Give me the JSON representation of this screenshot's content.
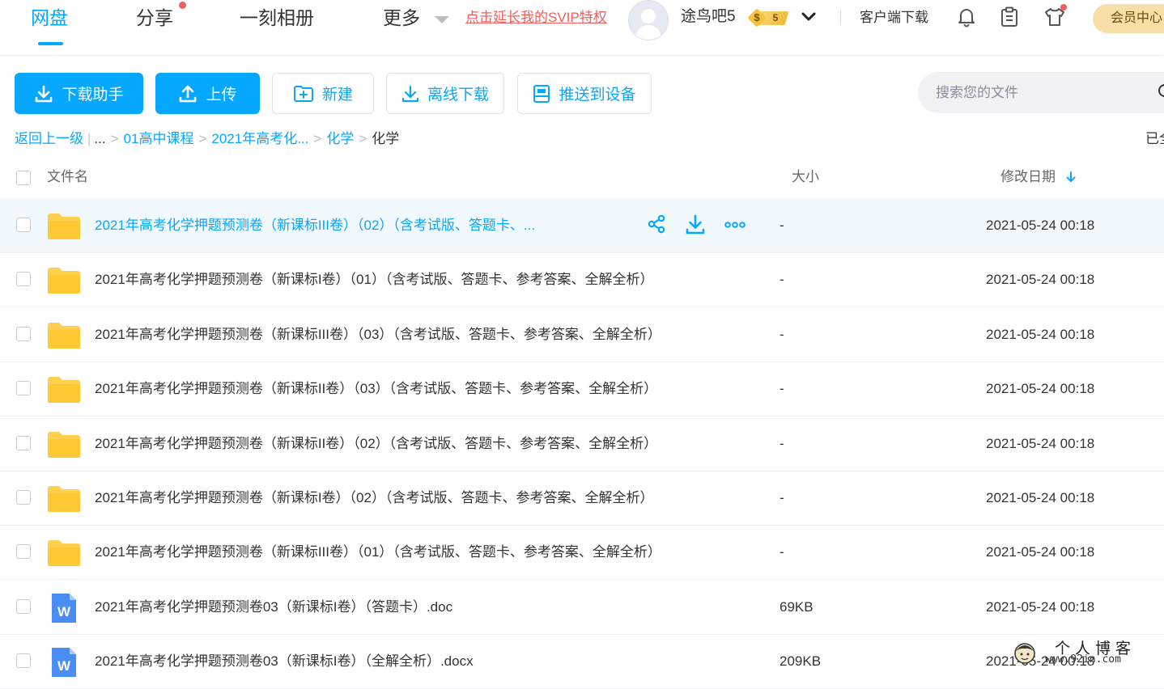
{
  "nav": {
    "tabs": [
      "网盘",
      "分享",
      "一刻相册",
      "更多"
    ],
    "svip_link": "点击延长我的SVIP特权",
    "username": "途鸟吧5",
    "coin_level": "5",
    "coin_symbol": "$",
    "client_download": "客户端下载",
    "vip_center": "会员中心"
  },
  "toolbar": {
    "download_helper": "下载助手",
    "upload": "上传",
    "new": "新建",
    "offline_download": "离线下载",
    "push_to_device": "推送到设备",
    "search_placeholder": "搜索您的文件"
  },
  "breadcrumb": {
    "back": "返回上一级",
    "ellipsis": "...",
    "items": [
      "01高中课程",
      "2021年高考化...",
      "化学",
      "化学"
    ],
    "loaded_status": "已全"
  },
  "table": {
    "headers": {
      "name": "文件名",
      "size": "大小",
      "date": "修改日期"
    },
    "rows": [
      {
        "name": "2021年高考化学押题预测卷（新课标III卷）（02）（含考试版、答题卡、...",
        "size": "-",
        "date": "2021-05-24 00:18",
        "type": "folder"
      },
      {
        "name": "2021年高考化学押题预测卷（新课标I卷）（01）（含考试版、答题卡、参考答案、全解全析）",
        "size": "-",
        "date": "2021-05-24 00:18",
        "type": "folder"
      },
      {
        "name": "2021年高考化学押题预测卷（新课标III卷）（03）（含考试版、答题卡、参考答案、全解全析）",
        "size": "-",
        "date": "2021-05-24 00:18",
        "type": "folder"
      },
      {
        "name": "2021年高考化学押题预测卷（新课标II卷）（03）（含考试版、答题卡、参考答案、全解全析）",
        "size": "-",
        "date": "2021-05-24 00:18",
        "type": "folder"
      },
      {
        "name": "2021年高考化学押题预测卷（新课标II卷）（02）（含考试版、答题卡、参考答案、全解全析）",
        "size": "-",
        "date": "2021-05-24 00:18",
        "type": "folder"
      },
      {
        "name": "2021年高考化学押题预测卷（新课标I卷）（02）（含考试版、答题卡、参考答案、全解全析）",
        "size": "-",
        "date": "2021-05-24 00:18",
        "type": "folder"
      },
      {
        "name": "2021年高考化学押题预测卷（新课标III卷）（01）（含考试版、答题卡、参考答案、全解全析）",
        "size": "-",
        "date": "2021-05-24 00:18",
        "type": "folder"
      },
      {
        "name": "2021年高考化学押题预测卷03（新课标I卷）（答题卡）.doc",
        "size": "69KB",
        "date": "2021-05-24 00:18",
        "type": "word"
      },
      {
        "name": "2021年高考化学押题预测卷03（新课标I卷）（全解全析）.docx",
        "size": "209KB",
        "date": "2021-05-24 00:18",
        "type": "word"
      }
    ]
  },
  "watermark": {
    "title": "个人博客",
    "url": "www.92in.com"
  },
  "colors": {
    "accent": "#06a7ff",
    "red": "#f25d5d",
    "folder": "#ffd04d",
    "word": "#4a8ef5"
  }
}
